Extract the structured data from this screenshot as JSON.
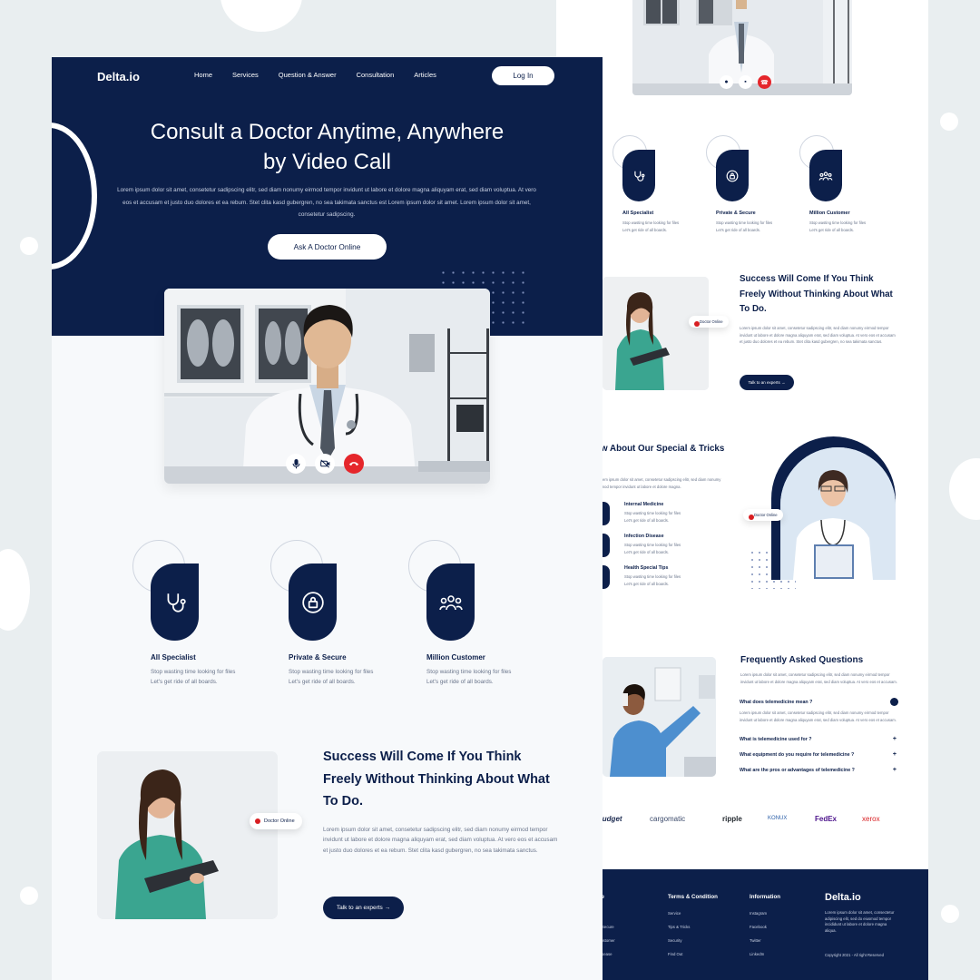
{
  "nav": {
    "logo": "Delta.io",
    "links": [
      "Home",
      "Services",
      "Question & Answer",
      "Consultation",
      "Articles"
    ],
    "login": "Log In"
  },
  "hero": {
    "title_line1": "Consult a Doctor Anytime, Anywhere",
    "title_line2": "by Video Call",
    "body": "Lorem ipsum dolor sit amet, consetetur sadipscing elitr, sed diam nonumy eirmod tempor invidunt ut labore et dolore magna aliquyam erat, sed diam voluptua. At vero eos et accusam et justo duo dolores et ea rebum. Stet clita kasd gubergren, no sea takimata sanctus est Lorem ipsum dolor sit amet. Lorem ipsum dolor sit amet, consetetur sadipscing.",
    "cta": "Ask A Doctor Online"
  },
  "call_controls": {
    "mic": "mic-icon",
    "camera": "camera-off-icon",
    "end": "phone-end-icon",
    "end_color": "#e5262b"
  },
  "features": [
    {
      "title": "All Specialist",
      "desc_line1": "Stop wasting time looking for files",
      "desc_line2": "Let's get ride of all boards.",
      "icon": "stethoscope-icon"
    },
    {
      "title": "Private & Secure",
      "desc_line1": "Stop wasting time looking for files",
      "desc_line2": "Let's get ride of all boards.",
      "icon": "lock-icon"
    },
    {
      "title": "Million Customer",
      "desc_line1": "Stop wasting time looking for files",
      "desc_line2": "Let's get ride of all boards.",
      "icon": "users-icon"
    }
  ],
  "success": {
    "title": "Success Will Come If You Think Freely Without Thinking About What To Do.",
    "badge": "Doctor Online",
    "body": "Lorem ipsum dolor sit amet, consetetur sadipscing elitr, sed diam nonumy eirmod tempor invidunt ut labore et dolore magna aliquyam erat, sed diam voluptua. At vero eos et accusam et justo duo dolores et ea rebum. Stet clita kasd gubergren, no sea takimata sanctus.",
    "cta": "Talk to an experts"
  },
  "tips": {
    "title": "Know About Our Special & Tricks",
    "intro": "Lorem ipsum dolor sit amet, consetetur sadipscing elitr, sed diam nonumy eirmod tempor invidunt ut labore et dolore magna.",
    "badge": "Doctor Online",
    "items": [
      {
        "title": "Internal Medicine",
        "desc_line1": "Stop wasting time looking for files",
        "desc_line2": "Let's get ride of all boards."
      },
      {
        "title": "Infection Disease",
        "desc_line1": "Stop wasting time looking for files",
        "desc_line2": "Let's get ride of all boards."
      },
      {
        "title": "Health Special Tips",
        "desc_line1": "Stop wasting time looking for files",
        "desc_line2": "Let's get ride of all boards."
      }
    ]
  },
  "faq": {
    "title": "Frequently Asked Questions",
    "intro": "Lorem ipsum dolor sit amet, consetetur sadipscing elitr, sed diam nonumy eirmod tempor invidunt ut labore et dolore magna aliquyam erat, sed diam voluptua. At vero eos et accusam.",
    "answer": "Lorem ipsum dolor sit amet, consetetur sadipscing elitr, sed diam nonumy eirmod tempor invidunt ut labore et dolore magna aliquyam erat, sed diam voluptua. At vero eos et accusam.",
    "questions": [
      "What does telemedicine mean ?",
      "What is telemedicine used for ?",
      "What equipment do you require for telemedicine ?",
      "What are the pros or advantages of telemedicine ?"
    ],
    "toggle_plus": "+"
  },
  "brands": [
    "Budget",
    "cargomatic",
    "ripple",
    "KONUX",
    "FedEx",
    "xerox"
  ],
  "footer": {
    "col1_partial": "ce",
    "col1_items": [
      "ist",
      "& Secure",
      "Customer",
      "Disease"
    ],
    "terms_title": "Terms & Condition",
    "terms_items": [
      "Service",
      "Tips & Tricks",
      "Security",
      "Find Out"
    ],
    "info_title": "Information",
    "info_items": [
      "Instagram",
      "Facebook",
      "Twitter",
      "LinkedIn"
    ],
    "logo": "Delta.io",
    "about": "Lorem ipsum dolor sit amet, consectetur adipiscing elit, sed do eiusmod tempor incididunt ut labore et dolore magna aliqua.",
    "copyright": "Copyright 2021 - All right Reserved"
  },
  "colors": {
    "navy": "#0c1f4a",
    "accent_red": "#d81e22",
    "page_bg": "#e9eef0"
  }
}
